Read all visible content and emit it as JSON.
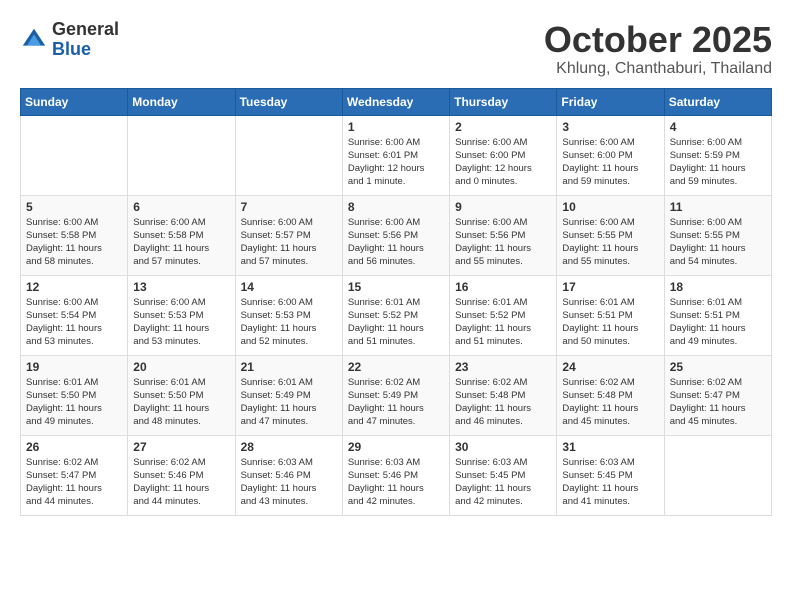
{
  "logo": {
    "general": "General",
    "blue": "Blue"
  },
  "title": "October 2025",
  "location": "Khlung, Chanthaburi, Thailand",
  "weekdays": [
    "Sunday",
    "Monday",
    "Tuesday",
    "Wednesday",
    "Thursday",
    "Friday",
    "Saturday"
  ],
  "weeks": [
    [
      {
        "day": "",
        "info": ""
      },
      {
        "day": "",
        "info": ""
      },
      {
        "day": "",
        "info": ""
      },
      {
        "day": "1",
        "info": "Sunrise: 6:00 AM\nSunset: 6:01 PM\nDaylight: 12 hours\nand 1 minute."
      },
      {
        "day": "2",
        "info": "Sunrise: 6:00 AM\nSunset: 6:00 PM\nDaylight: 12 hours\nand 0 minutes."
      },
      {
        "day": "3",
        "info": "Sunrise: 6:00 AM\nSunset: 6:00 PM\nDaylight: 11 hours\nand 59 minutes."
      },
      {
        "day": "4",
        "info": "Sunrise: 6:00 AM\nSunset: 5:59 PM\nDaylight: 11 hours\nand 59 minutes."
      }
    ],
    [
      {
        "day": "5",
        "info": "Sunrise: 6:00 AM\nSunset: 5:58 PM\nDaylight: 11 hours\nand 58 minutes."
      },
      {
        "day": "6",
        "info": "Sunrise: 6:00 AM\nSunset: 5:58 PM\nDaylight: 11 hours\nand 57 minutes."
      },
      {
        "day": "7",
        "info": "Sunrise: 6:00 AM\nSunset: 5:57 PM\nDaylight: 11 hours\nand 57 minutes."
      },
      {
        "day": "8",
        "info": "Sunrise: 6:00 AM\nSunset: 5:56 PM\nDaylight: 11 hours\nand 56 minutes."
      },
      {
        "day": "9",
        "info": "Sunrise: 6:00 AM\nSunset: 5:56 PM\nDaylight: 11 hours\nand 55 minutes."
      },
      {
        "day": "10",
        "info": "Sunrise: 6:00 AM\nSunset: 5:55 PM\nDaylight: 11 hours\nand 55 minutes."
      },
      {
        "day": "11",
        "info": "Sunrise: 6:00 AM\nSunset: 5:55 PM\nDaylight: 11 hours\nand 54 minutes."
      }
    ],
    [
      {
        "day": "12",
        "info": "Sunrise: 6:00 AM\nSunset: 5:54 PM\nDaylight: 11 hours\nand 53 minutes."
      },
      {
        "day": "13",
        "info": "Sunrise: 6:00 AM\nSunset: 5:53 PM\nDaylight: 11 hours\nand 53 minutes."
      },
      {
        "day": "14",
        "info": "Sunrise: 6:00 AM\nSunset: 5:53 PM\nDaylight: 11 hours\nand 52 minutes."
      },
      {
        "day": "15",
        "info": "Sunrise: 6:01 AM\nSunset: 5:52 PM\nDaylight: 11 hours\nand 51 minutes."
      },
      {
        "day": "16",
        "info": "Sunrise: 6:01 AM\nSunset: 5:52 PM\nDaylight: 11 hours\nand 51 minutes."
      },
      {
        "day": "17",
        "info": "Sunrise: 6:01 AM\nSunset: 5:51 PM\nDaylight: 11 hours\nand 50 minutes."
      },
      {
        "day": "18",
        "info": "Sunrise: 6:01 AM\nSunset: 5:51 PM\nDaylight: 11 hours\nand 49 minutes."
      }
    ],
    [
      {
        "day": "19",
        "info": "Sunrise: 6:01 AM\nSunset: 5:50 PM\nDaylight: 11 hours\nand 49 minutes."
      },
      {
        "day": "20",
        "info": "Sunrise: 6:01 AM\nSunset: 5:50 PM\nDaylight: 11 hours\nand 48 minutes."
      },
      {
        "day": "21",
        "info": "Sunrise: 6:01 AM\nSunset: 5:49 PM\nDaylight: 11 hours\nand 47 minutes."
      },
      {
        "day": "22",
        "info": "Sunrise: 6:02 AM\nSunset: 5:49 PM\nDaylight: 11 hours\nand 47 minutes."
      },
      {
        "day": "23",
        "info": "Sunrise: 6:02 AM\nSunset: 5:48 PM\nDaylight: 11 hours\nand 46 minutes."
      },
      {
        "day": "24",
        "info": "Sunrise: 6:02 AM\nSunset: 5:48 PM\nDaylight: 11 hours\nand 45 minutes."
      },
      {
        "day": "25",
        "info": "Sunrise: 6:02 AM\nSunset: 5:47 PM\nDaylight: 11 hours\nand 45 minutes."
      }
    ],
    [
      {
        "day": "26",
        "info": "Sunrise: 6:02 AM\nSunset: 5:47 PM\nDaylight: 11 hours\nand 44 minutes."
      },
      {
        "day": "27",
        "info": "Sunrise: 6:02 AM\nSunset: 5:46 PM\nDaylight: 11 hours\nand 44 minutes."
      },
      {
        "day": "28",
        "info": "Sunrise: 6:03 AM\nSunset: 5:46 PM\nDaylight: 11 hours\nand 43 minutes."
      },
      {
        "day": "29",
        "info": "Sunrise: 6:03 AM\nSunset: 5:46 PM\nDaylight: 11 hours\nand 42 minutes."
      },
      {
        "day": "30",
        "info": "Sunrise: 6:03 AM\nSunset: 5:45 PM\nDaylight: 11 hours\nand 42 minutes."
      },
      {
        "day": "31",
        "info": "Sunrise: 6:03 AM\nSunset: 5:45 PM\nDaylight: 11 hours\nand 41 minutes."
      },
      {
        "day": "",
        "info": ""
      }
    ]
  ]
}
